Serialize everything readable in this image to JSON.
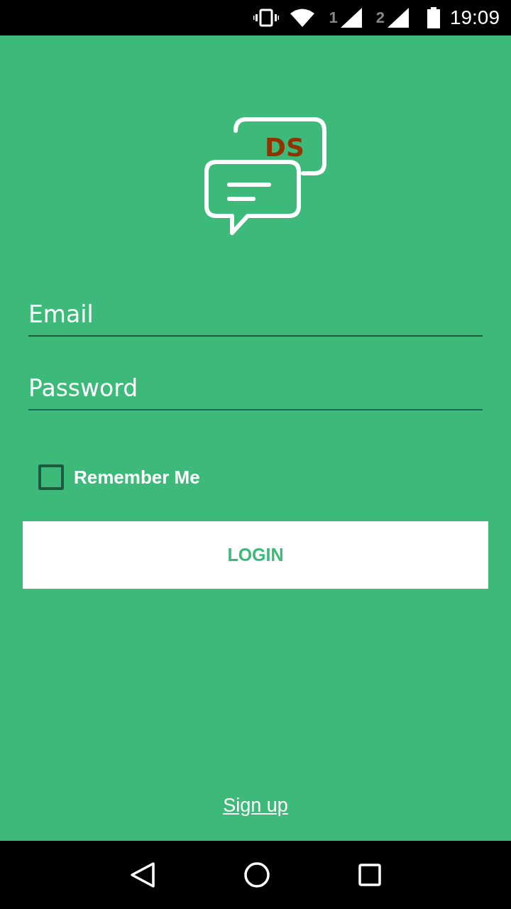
{
  "status_bar": {
    "sim_1": "1",
    "sim_2": "2",
    "time": "19:09"
  },
  "logo": {
    "text": "DS"
  },
  "fields": [
    {
      "placeholder": "Email"
    },
    {
      "placeholder": "Password"
    }
  ],
  "remember": {
    "label": "Remember Me",
    "checked": false
  },
  "login_button": {
    "label": "LOGIN"
  },
  "signup_link": {
    "label": "Sign up"
  }
}
